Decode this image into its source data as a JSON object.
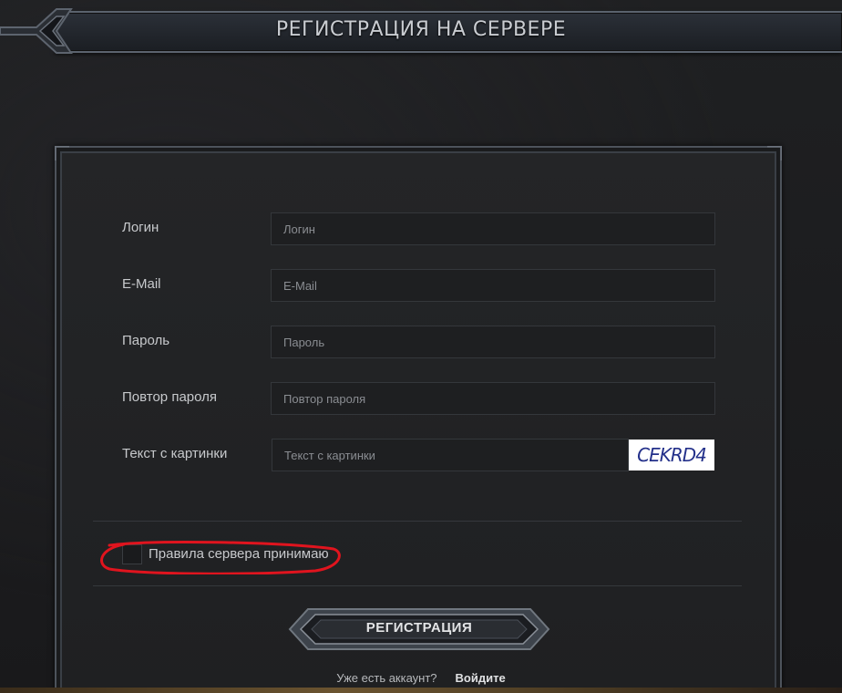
{
  "header": {
    "title": "РЕГИСТРАЦИЯ НА СЕРВЕРЕ"
  },
  "form": {
    "fields": [
      {
        "label": "Логин",
        "placeholder": "Логин"
      },
      {
        "label": "E-Mail",
        "placeholder": "E-Mail"
      },
      {
        "label": "Пароль",
        "placeholder": "Пароль"
      },
      {
        "label": "Повтор пароля",
        "placeholder": "Повтор пароля"
      },
      {
        "label": "Текст с картинки",
        "placeholder": "Текст с картинки"
      }
    ],
    "captcha_text": "CEKRD4",
    "rules_checkbox_label": "Правила сервера принимаю",
    "rules_checked": false,
    "submit_label": "РЕГИСТРАЦИЯ"
  },
  "footer": {
    "prompt": "Уже есть аккаунт?",
    "login_link": "Войдите"
  },
  "colors": {
    "background": "#1c1d1f",
    "annotation": "#e0141e",
    "captcha_text": "#23308a"
  }
}
